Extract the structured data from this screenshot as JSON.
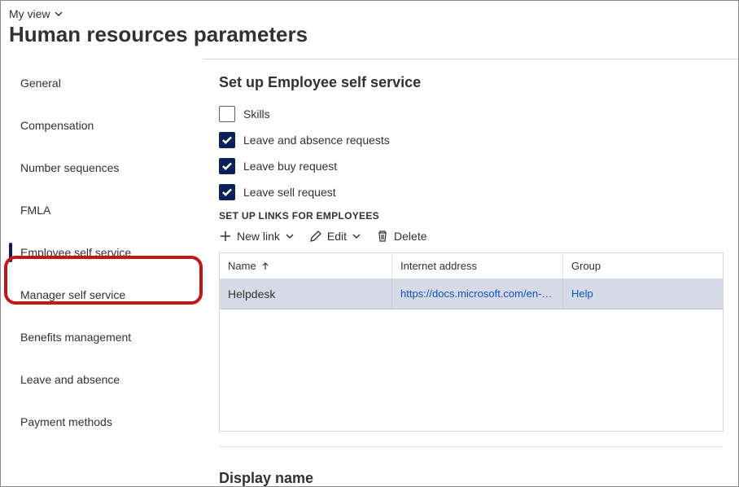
{
  "header": {
    "view_label": "My view",
    "page_title": "Human resources parameters"
  },
  "sidebar": {
    "items": [
      {
        "label": "General",
        "active": false
      },
      {
        "label": "Compensation",
        "active": false
      },
      {
        "label": "Number sequences",
        "active": false
      },
      {
        "label": "FMLA",
        "active": false
      },
      {
        "label": "Employee self service",
        "active": true
      },
      {
        "label": "Manager self service",
        "active": false
      },
      {
        "label": "Benefits management",
        "active": false
      },
      {
        "label": "Leave and absence",
        "active": false
      },
      {
        "label": "Payment methods",
        "active": false
      }
    ]
  },
  "main": {
    "section_title": "Set up Employee self service",
    "checkboxes": [
      {
        "label": "Skills",
        "checked": false
      },
      {
        "label": "Leave and absence requests",
        "checked": true
      },
      {
        "label": "Leave buy request",
        "checked": true
      },
      {
        "label": "Leave sell request",
        "checked": true
      }
    ],
    "links_caption": "SET UP LINKS FOR EMPLOYEES",
    "toolbar": {
      "new_link": "New link",
      "edit": "Edit",
      "delete": "Delete"
    },
    "table": {
      "columns": {
        "name": "Name",
        "url": "Internet address",
        "group": "Group"
      },
      "rows": [
        {
          "name": "Helpdesk",
          "url": "https://docs.microsoft.com/en-u...",
          "group": "Help"
        }
      ]
    },
    "display_name_title": "Display name"
  }
}
